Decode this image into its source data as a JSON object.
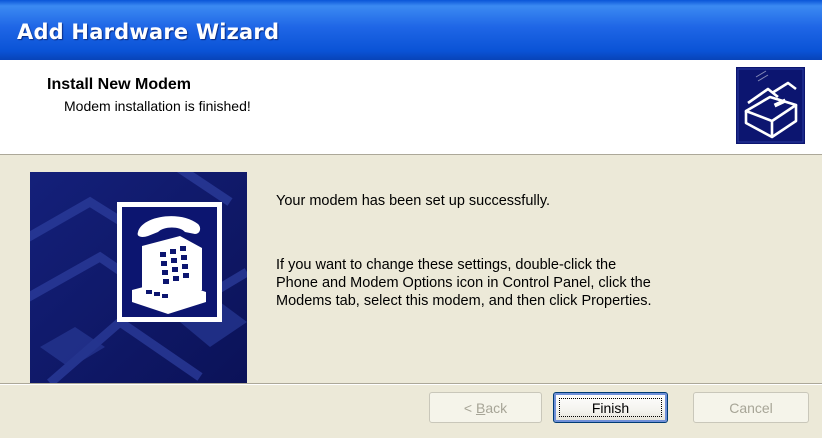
{
  "window": {
    "title": "Add Hardware Wizard"
  },
  "header": {
    "title": "Install New Modem",
    "subtitle": "Modem installation is finished!",
    "icon": "hardware-box-icon"
  },
  "content": {
    "illustration_icon": "phone-modem-icon",
    "line1": "Your modem has been set up successfully.",
    "para": [
      "If you want to change these settings, double-click the",
      "Phone and Modem Options icon in Control Panel, click the",
      "Modems tab, select this modem, and then click Properties."
    ]
  },
  "buttons": {
    "back": {
      "label_prefix": "< ",
      "label_access": "B",
      "label_rest": "ack",
      "enabled": false
    },
    "finish": {
      "label": "Finish",
      "default": true
    },
    "cancel": {
      "label": "Cancel",
      "enabled": false
    }
  },
  "colors": {
    "titlebar": "#0a53d6",
    "dialog": "#ece9d8",
    "art_background": "#0f1a66"
  }
}
